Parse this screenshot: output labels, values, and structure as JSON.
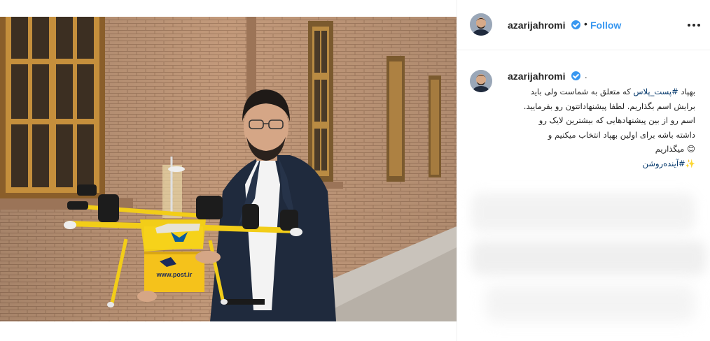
{
  "post": {
    "username": "azarijahromi",
    "follow_label": "Follow",
    "separator": "•",
    "caption_trail": "."
  },
  "caption": {
    "line1_prefix": "بهپاد ",
    "line1_tag": "#پست_پلاس",
    "line1_suffix": " که متعلق به شماست ولی باید",
    "line2": "برایش اسم بگذاریم. لطفا پیشنهاداتتون رو بفرمایید.",
    "line3": "اسم رو از بین پیشنهادهایی که بیشترین لایک رو",
    "line4": "داشته باشه برای اولین بهپاد انتخاب میکنیم و",
    "line5": "میگذاریم",
    "line5_emoji": "😊",
    "line6_tag": "#آینده‌روشن",
    "line6_emoji": "✨"
  },
  "photo": {
    "box_text": "www.post.ir"
  },
  "colors": {
    "link": "#3897f0",
    "hashtag": "#003569",
    "verified": "#3897f0",
    "drone_yellow": "#f2cd18"
  }
}
